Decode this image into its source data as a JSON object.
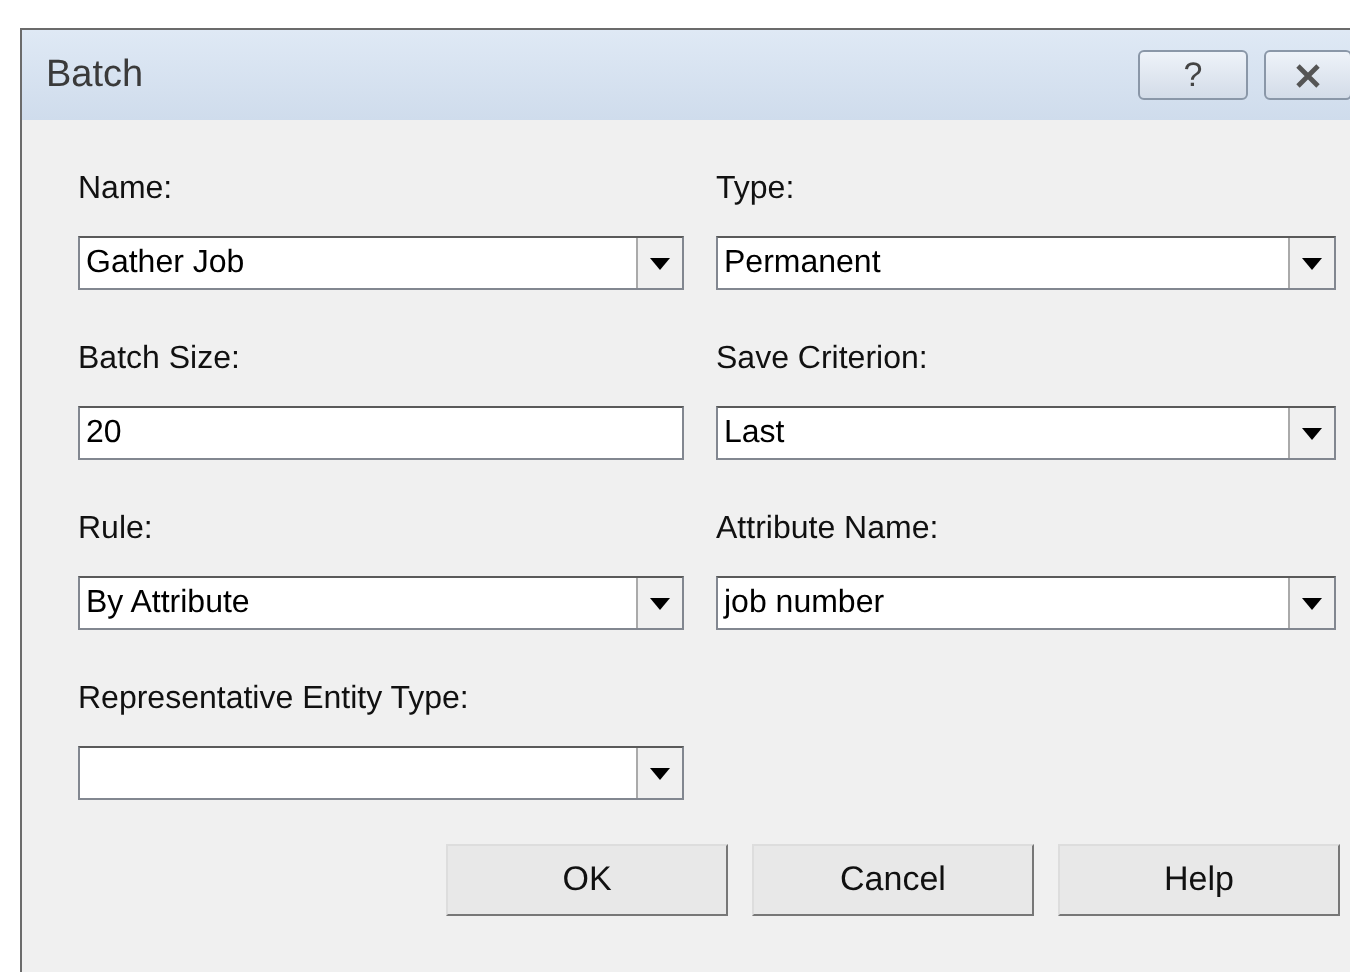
{
  "window": {
    "title": "Batch",
    "help_button": "?"
  },
  "fields": [
    {
      "label": "Name:",
      "value": "Gather Job",
      "kind": "combo"
    },
    {
      "label": "Type:",
      "value": "Permanent",
      "kind": "combo"
    },
    {
      "label": "Batch Size:",
      "value": "20",
      "kind": "text"
    },
    {
      "label": "Save Criterion:",
      "value": "Last",
      "kind": "combo"
    },
    {
      "label": "Rule:",
      "value": "By Attribute",
      "kind": "combo"
    },
    {
      "label": "Attribute Name:",
      "value": "job number",
      "kind": "combo"
    },
    {
      "label": "Representative Entity Type:",
      "kind": "combo"
    }
  ],
  "buttons": [
    "OK",
    "Cancel",
    "Help"
  ]
}
